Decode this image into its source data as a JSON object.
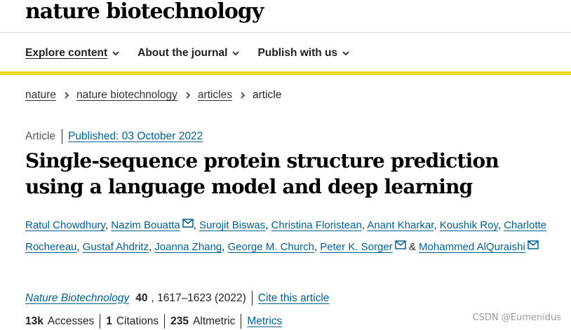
{
  "header": {
    "brand": "nature biotechnology"
  },
  "nav": [
    {
      "label": "Explore content",
      "icon": "chevron-down-icon"
    },
    {
      "label": "About the journal",
      "icon": "chevron-down-icon"
    },
    {
      "label": "Publish with us",
      "icon": "chevron-down-icon"
    }
  ],
  "colors": {
    "accent_bar": "#f1d81c",
    "link": "#025e8d",
    "text": "#222222"
  },
  "breadcrumb": {
    "items": [
      "nature",
      "nature biotechnology",
      "articles"
    ],
    "current": "article"
  },
  "article": {
    "type": "Article",
    "published": "Published: 03 October 2022",
    "title": "Single-sequence protein structure prediction using a language model and deep learning",
    "authors": [
      "Ratul Chowdhury",
      "Nazim Bouatta",
      "Surojit Biswas",
      "Christina Floristean",
      "Anant Kharkar",
      "Koushik Roy",
      "Charlotte Rochereau",
      "Gustaf Ahdritz",
      "Joanna Zhang",
      "George M. Church",
      "Peter K. Sorger",
      "Mohammed AlQuraishi"
    ],
    "corresponding_author_icon": "mail-icon",
    "and_text": "&",
    "citation": {
      "journal": "Nature Biotechnology",
      "volume": "40",
      "pages_year": ", 1617–1623 (2022)",
      "cite_link": "Cite this article"
    },
    "metrics": {
      "accesses_value": "13k",
      "accesses_label": "Accesses",
      "citations_value": "1",
      "citations_label": "Citations",
      "altmetric_value": "235",
      "altmetric_label": "Altmetric",
      "metrics_link": "Metrics"
    }
  },
  "watermark": "CSDN @Eumenidus"
}
